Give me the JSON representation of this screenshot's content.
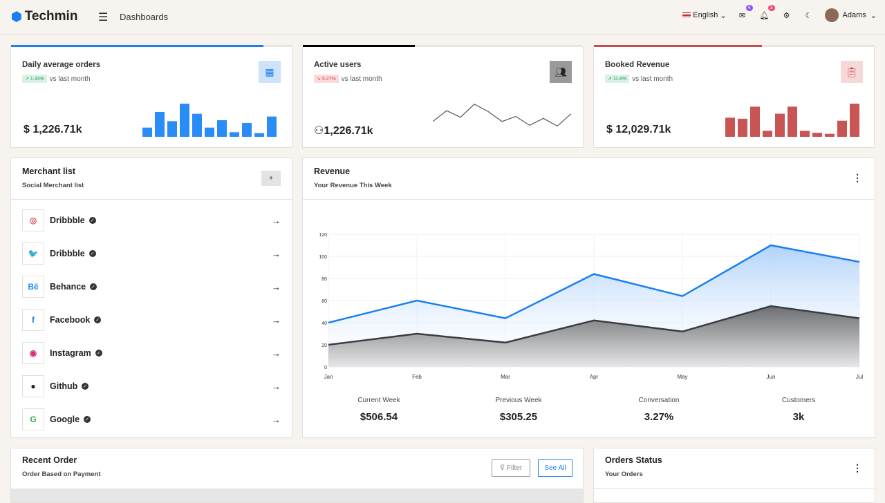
{
  "header": {
    "brand": "Techmin",
    "breadcrumb": "Dashboards",
    "language": "English",
    "mail_count": "4",
    "notif_count": "3",
    "user": "Adams"
  },
  "cards": [
    {
      "title": "Daily average orders",
      "change": "1.33%",
      "vs": "vs last month",
      "value": "$ 1,226.71k",
      "accent": "#1a7ff0",
      "progress": 0.9,
      "bars": [
        10,
        27,
        17,
        36,
        25,
        10,
        18,
        5,
        15,
        4,
        22
      ]
    },
    {
      "title": "Active users",
      "change": "5.27%",
      "vs": "vs last month",
      "value": "1,226.71k",
      "accent": "#000000",
      "progress": 0.4,
      "line": [
        40,
        68,
        51,
        85,
        66,
        40,
        53,
        30,
        48,
        28,
        60
      ]
    },
    {
      "title": "Booked Revenue",
      "change": "11.8%",
      "vs": "vs last month",
      "value": "$ 12,029.71k",
      "accent": "#c44d4d",
      "progress": 0.6,
      "bars": [
        19,
        18,
        30,
        6,
        23,
        30,
        6,
        4,
        3,
        16,
        33
      ]
    }
  ],
  "merchants": {
    "title": "Merchant list",
    "subtitle": "Social Merchant list",
    "add": "+",
    "items": [
      {
        "name": "Dribbble",
        "icon": "dribbble",
        "glyph": "◎",
        "color": "#e04f5f"
      },
      {
        "name": "Dribbble",
        "icon": "twitter",
        "glyph": "🐦",
        "color": "#1da1f2"
      },
      {
        "name": "Behance",
        "icon": "behance",
        "glyph": "Bē",
        "color": "#1a8fff"
      },
      {
        "name": "Facebook",
        "icon": "facebook",
        "glyph": "f",
        "color": "#1877f2"
      },
      {
        "name": "Instagram",
        "icon": "instagram",
        "glyph": "◉",
        "color": "#d62976"
      },
      {
        "name": "Github",
        "icon": "github",
        "glyph": "●",
        "color": "#222"
      },
      {
        "name": "Google",
        "icon": "google",
        "glyph": "G",
        "color": "#34a853"
      }
    ]
  },
  "revenue": {
    "title": "Revenue",
    "subtitle": "Your Revenue This Week",
    "stats": [
      {
        "label": "Current Week",
        "value": "$506.54"
      },
      {
        "label": "Previous Week",
        "value": "$305.25"
      },
      {
        "label": "Conversation",
        "value": "3.27%"
      },
      {
        "label": "Customers",
        "value": "3k"
      }
    ]
  },
  "chart_data": {
    "type": "area",
    "categories": [
      "Jan",
      "Feb",
      "Mar",
      "Apr",
      "May",
      "Jun",
      "Jul"
    ],
    "ylim": [
      0,
      120
    ],
    "yticks": [
      0,
      20,
      40,
      60,
      80,
      100,
      120
    ],
    "series": [
      {
        "name": "Current",
        "color": "#1a7ff0",
        "values": [
          40,
          60,
          44,
          84,
          64,
          110,
          95
        ]
      },
      {
        "name": "Previous",
        "color": "#3a3d42",
        "values": [
          20,
          30,
          22,
          42,
          32,
          55,
          44
        ]
      }
    ]
  },
  "recent": {
    "title": "Recent Order",
    "subtitle": "Order Based on Payment",
    "filter": "Filter",
    "see_all": "See All"
  },
  "orders_status": {
    "title": "Orders Status",
    "subtitle": "Your Orders"
  }
}
